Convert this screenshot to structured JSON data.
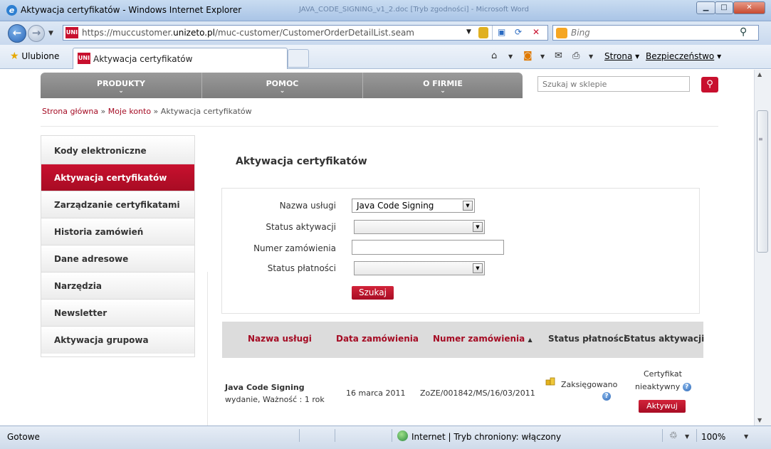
{
  "window": {
    "title": "Aktywacja certyfikatów - Windows Internet Explorer",
    "background_doc": "JAVA_CODE_SIGNING_v1_2.doc [Tryb zgodności] - Microsoft Word",
    "min_label": "▁",
    "max_label": "□",
    "close_label": "✕"
  },
  "address_bar": {
    "url_prefix": "https://muccustomer.",
    "url_domain": "unizeto.pl",
    "url_suffix": "/muc-customer/CustomerOrderDetailList.seam",
    "site_icon_text": "UNI"
  },
  "search_bar": {
    "placeholder": "Bing"
  },
  "favorites": {
    "label": "Ulubione"
  },
  "tabs": [
    {
      "label": "Aktywacja certyfikatów",
      "active": true
    }
  ],
  "command_bar": {
    "page_label": "Strona",
    "safety_label": "Bezpieczeństwo"
  },
  "site": {
    "menu": [
      {
        "label": "PRODUKTY"
      },
      {
        "label": "POMOC"
      },
      {
        "label": "O FIRMIE"
      }
    ],
    "search_placeholder": "Szukaj w sklepie"
  },
  "breadcrumb": {
    "home": "Strona główna",
    "sep1": " » ",
    "account": "Moje konto",
    "sep2": " » ",
    "current": "Aktywacja certyfikatów"
  },
  "sidebar": {
    "items": [
      {
        "label": "Kody elektroniczne",
        "active": false
      },
      {
        "label": "Aktywacja certyfikatów",
        "active": true
      },
      {
        "label": "Zarządzanie certyfikatami",
        "active": false
      },
      {
        "label": "Historia zamówień",
        "active": false
      },
      {
        "label": "Dane adresowe",
        "active": false
      },
      {
        "label": "Narzędzia",
        "active": false
      },
      {
        "label": "Newsletter",
        "active": false
      },
      {
        "label": "Aktywacja grupowa",
        "active": false
      }
    ]
  },
  "page": {
    "title": "Aktywacja certyfikatów"
  },
  "form": {
    "service_label": "Nazwa usługi",
    "service_value": "Java Code Signing",
    "activation_status_label": "Status aktywacji",
    "activation_status_value": "",
    "order_number_label": "Numer zamówienia",
    "order_number_value": "",
    "payment_status_label": "Status płatności",
    "payment_status_value": "",
    "search_button": "Szukaj"
  },
  "table": {
    "headers": {
      "service": "Nazwa usługi",
      "order_date": "Data zamówienia",
      "order_number": "Numer zamówienia",
      "sort_indicator": "▲",
      "payment_status": "Status płatności",
      "activation_status": "Status aktywacji"
    },
    "rows": [
      {
        "service_name": "Java Code Signing",
        "service_detail": "wydanie, Ważność : 1 rok",
        "order_date": "16 marca 2011",
        "order_number": "ZoZE/001842/MS/16/03/2011",
        "payment_status": "Zaksięgowano",
        "activation_status_line1": "Certyfikat",
        "activation_status_line2": "nieaktywny",
        "activate_button": "Aktywuj"
      }
    ]
  },
  "status_bar": {
    "text": "Gotowe",
    "zone": "Internet | Tryb chroniony: włączony",
    "zoom": "100%"
  },
  "colors": {
    "brand_red": "#c8102e",
    "menu_gray": "#8a8a8a",
    "link_red": "#a50c24"
  }
}
